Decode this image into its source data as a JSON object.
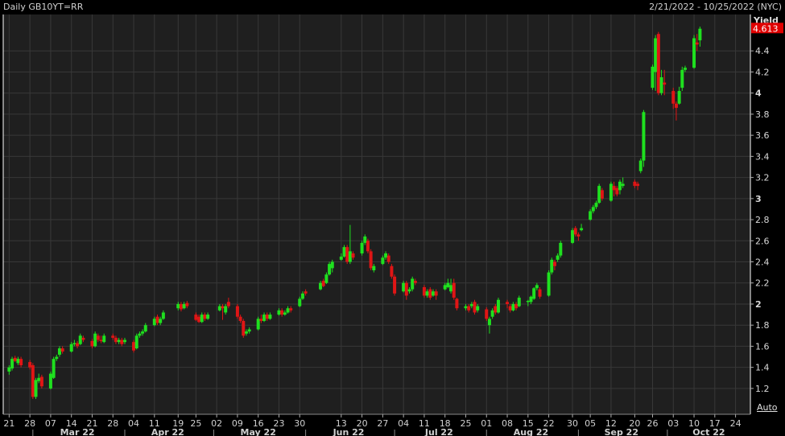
{
  "header": {
    "title": "Daily GB10YT=RR",
    "range": "2/21/2022 - 10/25/2022 (NYC)"
  },
  "auto_label": "Auto",
  "colors": {
    "up": "#1fe01f",
    "down": "#e01515",
    "background": "#1f1f1f",
    "grid": "#383838",
    "last_price_bg": "#e00000"
  },
  "chart_data": {
    "type": "candlestick",
    "title": "Daily GB10YT=RR",
    "ylabel": "Yield",
    "ylim": [
      0.955,
      4.745
    ],
    "yticks": [
      1.2,
      1.4,
      1.6,
      1.8,
      2,
      2.2,
      2.4,
      2.6,
      2.8,
      3,
      3.2,
      3.4,
      3.6,
      3.8,
      4,
      4.2,
      4.4
    ],
    "ytick_labels": [
      "1.2",
      "1.4",
      "1.6",
      "1.8",
      "2",
      "2.2",
      "2.4",
      "2.6",
      "2.8",
      "3",
      "3.2",
      "3.4",
      "3.6",
      "3.8",
      "4",
      "4.2",
      "4.4"
    ],
    "last_value": "4.613",
    "xlim": [
      "2022-02-19",
      "2022-10-29"
    ],
    "xticks": [
      {
        "date": "2022-02-21",
        "label": "21"
      },
      {
        "date": "2022-02-28",
        "label": "28"
      },
      {
        "date": "2022-03-07",
        "label": "07"
      },
      {
        "date": "2022-03-14",
        "label": "14"
      },
      {
        "date": "2022-03-21",
        "label": "21"
      },
      {
        "date": "2022-03-28",
        "label": "28"
      },
      {
        "date": "2022-04-04",
        "label": "04"
      },
      {
        "date": "2022-04-11",
        "label": "11"
      },
      {
        "date": "2022-04-19",
        "label": "19"
      },
      {
        "date": "2022-04-25",
        "label": "25"
      },
      {
        "date": "2022-05-02",
        "label": "02"
      },
      {
        "date": "2022-05-09",
        "label": "09"
      },
      {
        "date": "2022-05-16",
        "label": "16"
      },
      {
        "date": "2022-05-23",
        "label": "23"
      },
      {
        "date": "2022-05-30",
        "label": "30"
      },
      {
        "date": "2022-06-13",
        "label": "13"
      },
      {
        "date": "2022-06-20",
        "label": "20"
      },
      {
        "date": "2022-06-27",
        "label": "27"
      },
      {
        "date": "2022-07-04",
        "label": "04"
      },
      {
        "date": "2022-07-11",
        "label": "11"
      },
      {
        "date": "2022-07-18",
        "label": "18"
      },
      {
        "date": "2022-07-25",
        "label": "25"
      },
      {
        "date": "2022-08-01",
        "label": "01"
      },
      {
        "date": "2022-08-08",
        "label": "08"
      },
      {
        "date": "2022-08-15",
        "label": "15"
      },
      {
        "date": "2022-08-22",
        "label": "22"
      },
      {
        "date": "2022-08-30",
        "label": "30"
      },
      {
        "date": "2022-09-05",
        "label": "05"
      },
      {
        "date": "2022-09-12",
        "label": "12"
      },
      {
        "date": "2022-09-20",
        "label": "20"
      },
      {
        "date": "2022-09-26",
        "label": "26"
      },
      {
        "date": "2022-10-03",
        "label": "03"
      },
      {
        "date": "2022-10-10",
        "label": "10"
      },
      {
        "date": "2022-10-17",
        "label": "17"
      },
      {
        "date": "2022-10-24",
        "label": "24"
      }
    ],
    "months": [
      {
        "start": "2022-03-01",
        "end": "2022-03-31",
        "label": "Mar 22"
      },
      {
        "start": "2022-04-01",
        "end": "2022-04-30",
        "label": "Apr 22"
      },
      {
        "start": "2022-05-01",
        "end": "2022-05-31",
        "label": "May 22"
      },
      {
        "start": "2022-06-01",
        "end": "2022-06-30",
        "label": "Jun 22"
      },
      {
        "start": "2022-07-01",
        "end": "2022-07-31",
        "label": "Jul 22"
      },
      {
        "start": "2022-08-01",
        "end": "2022-08-31",
        "label": "Aug 22"
      },
      {
        "start": "2022-09-01",
        "end": "2022-09-30",
        "label": "Sep 22"
      },
      {
        "start": "2022-10-01",
        "end": "2022-10-31",
        "label": "Oct 22"
      }
    ],
    "candles_fields": [
      "date",
      "open",
      "high",
      "low",
      "close"
    ],
    "candles": [
      [
        "2022-02-21",
        1.36,
        1.42,
        1.33,
        1.4
      ],
      [
        "2022-02-22",
        1.39,
        1.5,
        1.37,
        1.48
      ],
      [
        "2022-02-23",
        1.49,
        1.51,
        1.45,
        1.46
      ],
      [
        "2022-02-24",
        1.44,
        1.5,
        1.42,
        1.48
      ],
      [
        "2022-02-25",
        1.48,
        1.5,
        1.4,
        1.42
      ],
      [
        "2022-02-28",
        1.45,
        1.47,
        1.38,
        1.4
      ],
      [
        "2022-03-01",
        1.42,
        1.44,
        1.1,
        1.12
      ],
      [
        "2022-03-02",
        1.12,
        1.3,
        1.1,
        1.28
      ],
      [
        "2022-03-03",
        1.27,
        1.34,
        1.25,
        1.3
      ],
      [
        "2022-03-04",
        1.31,
        1.33,
        1.2,
        1.22
      ],
      [
        "2022-03-07",
        1.2,
        1.36,
        1.19,
        1.34
      ],
      [
        "2022-03-08",
        1.3,
        1.5,
        1.29,
        1.48
      ],
      [
        "2022-03-09",
        1.48,
        1.52,
        1.46,
        1.5
      ],
      [
        "2022-03-10",
        1.52,
        1.6,
        1.5,
        1.58
      ],
      [
        "2022-03-11",
        1.58,
        1.6,
        1.53,
        1.55
      ],
      [
        "2022-03-14",
        1.55,
        1.64,
        1.54,
        1.62
      ],
      [
        "2022-03-15",
        1.62,
        1.66,
        1.6,
        1.63
      ],
      [
        "2022-03-16",
        1.63,
        1.65,
        1.58,
        1.6
      ],
      [
        "2022-03-17",
        1.62,
        1.72,
        1.61,
        1.7
      ],
      [
        "2022-03-18",
        1.68,
        1.7,
        1.64,
        1.66
      ],
      [
        "2022-03-21",
        1.65,
        1.67,
        1.58,
        1.6
      ],
      [
        "2022-03-22",
        1.6,
        1.74,
        1.59,
        1.72
      ],
      [
        "2022-03-23",
        1.7,
        1.72,
        1.64,
        1.66
      ],
      [
        "2022-03-24",
        1.66,
        1.7,
        1.63,
        1.65
      ],
      [
        "2022-03-25",
        1.64,
        1.72,
        1.63,
        1.7
      ],
      [
        "2022-03-28",
        1.7,
        1.72,
        1.66,
        1.68
      ],
      [
        "2022-03-29",
        1.68,
        1.7,
        1.62,
        1.64
      ],
      [
        "2022-03-30",
        1.64,
        1.68,
        1.62,
        1.66
      ],
      [
        "2022-03-31",
        1.66,
        1.68,
        1.6,
        1.62
      ],
      [
        "2022-04-01",
        1.64,
        1.68,
        1.62,
        1.66
      ],
      [
        "2022-04-04",
        1.64,
        1.66,
        1.54,
        1.56
      ],
      [
        "2022-04-05",
        1.58,
        1.72,
        1.57,
        1.7
      ],
      [
        "2022-04-06",
        1.7,
        1.74,
        1.68,
        1.72
      ],
      [
        "2022-04-07",
        1.72,
        1.76,
        1.7,
        1.74
      ],
      [
        "2022-04-08",
        1.74,
        1.82,
        1.73,
        1.8
      ],
      [
        "2022-04-11",
        1.8,
        1.88,
        1.79,
        1.86
      ],
      [
        "2022-04-12",
        1.88,
        1.9,
        1.8,
        1.82
      ],
      [
        "2022-04-13",
        1.82,
        1.88,
        1.8,
        1.86
      ],
      [
        "2022-04-14",
        1.86,
        1.94,
        1.85,
        1.92
      ],
      [
        "2022-04-19",
        1.96,
        2.02,
        1.94,
        2.0
      ],
      [
        "2022-04-20",
        2.0,
        2.02,
        1.93,
        1.95
      ],
      [
        "2022-04-21",
        1.96,
        2.02,
        1.95,
        2.0
      ],
      [
        "2022-04-22",
        2.01,
        2.03,
        1.96,
        1.98
      ],
      [
        "2022-04-25",
        1.9,
        1.92,
        1.84,
        1.85
      ],
      [
        "2022-04-26",
        1.88,
        1.9,
        1.82,
        1.83
      ],
      [
        "2022-04-27",
        1.83,
        1.92,
        1.82,
        1.9
      ],
      [
        "2022-04-28",
        1.9,
        1.92,
        1.84,
        1.86
      ],
      [
        "2022-04-29",
        1.86,
        1.92,
        1.85,
        1.9
      ],
      [
        "2022-05-03",
        1.94,
        2.0,
        1.93,
        1.98
      ],
      [
        "2022-05-04",
        1.98,
        2.0,
        1.85,
        1.96
      ],
      [
        "2022-05-05",
        1.92,
        2.0,
        1.9,
        1.98
      ],
      [
        "2022-05-06",
        2.02,
        2.06,
        1.96,
        1.98
      ],
      [
        "2022-05-09",
        1.98,
        2.0,
        1.86,
        1.88
      ],
      [
        "2022-05-10",
        1.88,
        1.9,
        1.82,
        1.84
      ],
      [
        "2022-05-11",
        1.84,
        1.86,
        1.68,
        1.7
      ],
      [
        "2022-05-12",
        1.72,
        1.76,
        1.7,
        1.74
      ],
      [
        "2022-05-13",
        1.74,
        1.78,
        1.72,
        1.76
      ],
      [
        "2022-05-16",
        1.76,
        1.88,
        1.75,
        1.86
      ],
      [
        "2022-05-17",
        1.86,
        1.9,
        1.82,
        1.84
      ],
      [
        "2022-05-18",
        1.84,
        1.92,
        1.83,
        1.9
      ],
      [
        "2022-05-19",
        1.9,
        1.92,
        1.84,
        1.86
      ],
      [
        "2022-05-20",
        1.86,
        1.92,
        1.85,
        1.9
      ],
      [
        "2022-05-23",
        1.9,
        1.96,
        1.89,
        1.94
      ],
      [
        "2022-05-24",
        1.94,
        1.96,
        1.88,
        1.9
      ],
      [
        "2022-05-25",
        1.9,
        1.94,
        1.89,
        1.92
      ],
      [
        "2022-05-26",
        1.92,
        1.98,
        1.91,
        1.96
      ],
      [
        "2022-05-27",
        1.96,
        1.98,
        1.92,
        1.94
      ],
      [
        "2022-05-30",
        1.98,
        2.07,
        1.97,
        2.05
      ],
      [
        "2022-05-31",
        2.05,
        2.12,
        2.04,
        2.1
      ],
      [
        "2022-06-01",
        2.12,
        2.14,
        2.08,
        2.1
      ],
      [
        "2022-06-06",
        2.14,
        2.22,
        2.13,
        2.2
      ],
      [
        "2022-06-07",
        2.22,
        2.24,
        2.16,
        2.17
      ],
      [
        "2022-06-08",
        2.2,
        2.3,
        2.19,
        2.28
      ],
      [
        "2022-06-09",
        2.28,
        2.4,
        2.27,
        2.38
      ],
      [
        "2022-06-10",
        2.34,
        2.42,
        2.3,
        2.4
      ],
      [
        "2022-06-13",
        2.42,
        2.48,
        2.41,
        2.45
      ],
      [
        "2022-06-14",
        2.45,
        2.56,
        2.44,
        2.54
      ],
      [
        "2022-06-15",
        2.54,
        2.56,
        2.38,
        2.4
      ],
      [
        "2022-06-16",
        2.4,
        2.75,
        2.38,
        2.5
      ],
      [
        "2022-06-17",
        2.48,
        2.5,
        2.42,
        2.44
      ],
      [
        "2022-06-20",
        2.48,
        2.6,
        2.46,
        2.58
      ],
      [
        "2022-06-21",
        2.58,
        2.66,
        2.56,
        2.64
      ],
      [
        "2022-06-22",
        2.6,
        2.62,
        2.48,
        2.5
      ],
      [
        "2022-06-23",
        2.5,
        2.52,
        2.32,
        2.34
      ],
      [
        "2022-06-24",
        2.32,
        2.38,
        2.3,
        2.36
      ],
      [
        "2022-06-27",
        2.38,
        2.46,
        2.37,
        2.44
      ],
      [
        "2022-06-28",
        2.44,
        2.5,
        2.42,
        2.48
      ],
      [
        "2022-06-29",
        2.46,
        2.48,
        2.38,
        2.4
      ],
      [
        "2022-06-30",
        2.36,
        2.38,
        2.24,
        2.26
      ],
      [
        "2022-07-01",
        2.26,
        2.28,
        2.08,
        2.1
      ],
      [
        "2022-07-04",
        2.12,
        2.22,
        2.11,
        2.2
      ],
      [
        "2022-07-05",
        2.2,
        2.22,
        2.04,
        2.08
      ],
      [
        "2022-07-06",
        2.12,
        2.16,
        2.1,
        2.14
      ],
      [
        "2022-07-07",
        2.14,
        2.26,
        2.12,
        2.24
      ],
      [
        "2022-07-08",
        2.22,
        2.24,
        2.18,
        2.2
      ],
      [
        "2022-07-11",
        2.16,
        2.18,
        2.06,
        2.08
      ],
      [
        "2022-07-12",
        2.08,
        2.14,
        2.06,
        2.12
      ],
      [
        "2022-07-13",
        2.14,
        2.16,
        2.04,
        2.06
      ],
      [
        "2022-07-14",
        2.08,
        2.14,
        2.07,
        2.12
      ],
      [
        "2022-07-15",
        2.12,
        2.14,
        2.04,
        2.08
      ],
      [
        "2022-07-18",
        2.14,
        2.2,
        2.13,
        2.18
      ],
      [
        "2022-07-19",
        2.16,
        2.24,
        2.15,
        2.2
      ],
      [
        "2022-07-20",
        2.12,
        2.24,
        2.1,
        2.18
      ],
      [
        "2022-07-21",
        2.2,
        2.24,
        2.04,
        2.06
      ],
      [
        "2022-07-22",
        2.05,
        2.06,
        1.94,
        1.96
      ],
      [
        "2022-07-25",
        1.96,
        2.0,
        1.94,
        1.98
      ],
      [
        "2022-07-26",
        1.98,
        2.0,
        1.92,
        1.94
      ],
      [
        "2022-07-27",
        1.98,
        2.02,
        1.96,
        2.0
      ],
      [
        "2022-07-28",
        2.02,
        2.04,
        1.9,
        1.92
      ],
      [
        "2022-07-29",
        1.94,
        2.0,
        1.92,
        1.98
      ],
      [
        "2022-08-01",
        1.95,
        1.97,
        1.84,
        1.86
      ],
      [
        "2022-08-02",
        1.8,
        1.88,
        1.72,
        1.86
      ],
      [
        "2022-08-03",
        1.88,
        1.96,
        1.86,
        1.94
      ],
      [
        "2022-08-04",
        1.98,
        2.0,
        1.9,
        1.92
      ],
      [
        "2022-08-05",
        1.92,
        2.06,
        1.91,
        2.04
      ],
      [
        "2022-08-08",
        2.02,
        2.04,
        1.96,
        2.0
      ],
      [
        "2022-08-09",
        1.98,
        2.0,
        1.92,
        1.94
      ],
      [
        "2022-08-10",
        1.94,
        2.02,
        1.93,
        2.0
      ],
      [
        "2022-08-11",
        2.0,
        2.02,
        1.94,
        1.96
      ],
      [
        "2022-08-12",
        1.98,
        2.08,
        1.97,
        2.06
      ],
      [
        "2022-08-15",
        2.02,
        2.04,
        1.98,
        2.03
      ],
      [
        "2022-08-16",
        2.02,
        2.08,
        2.0,
        2.07
      ],
      [
        "2022-08-17",
        2.05,
        2.16,
        2.04,
        2.15
      ],
      [
        "2022-08-18",
        2.15,
        2.2,
        2.13,
        2.18
      ],
      [
        "2022-08-19",
        2.14,
        2.16,
        2.05,
        2.07
      ],
      [
        "2022-08-22",
        2.08,
        2.32,
        2.07,
        2.3
      ],
      [
        "2022-08-23",
        2.3,
        2.44,
        2.28,
        2.42
      ],
      [
        "2022-08-24",
        2.4,
        2.42,
        2.32,
        2.36
      ],
      [
        "2022-08-25",
        2.42,
        2.48,
        2.4,
        2.46
      ],
      [
        "2022-08-26",
        2.46,
        2.6,
        2.44,
        2.58
      ],
      [
        "2022-08-30",
        2.58,
        2.72,
        2.57,
        2.7
      ],
      [
        "2022-08-31",
        2.72,
        2.74,
        2.64,
        2.66
      ],
      [
        "2022-09-01",
        2.66,
        2.68,
        2.6,
        2.64
      ],
      [
        "2022-09-02",
        2.7,
        2.76,
        2.69,
        2.72
      ],
      [
        "2022-09-05",
        2.8,
        2.9,
        2.79,
        2.88
      ],
      [
        "2022-09-06",
        2.88,
        2.94,
        2.86,
        2.92
      ],
      [
        "2022-09-07",
        2.92,
        2.98,
        2.9,
        2.96
      ],
      [
        "2022-09-08",
        2.96,
        3.14,
        2.95,
        3.12
      ],
      [
        "2022-09-09",
        3.08,
        3.1,
        2.98,
        3.0
      ],
      [
        "2022-09-12",
        2.98,
        3.16,
        2.97,
        3.14
      ],
      [
        "2022-09-13",
        3.12,
        3.16,
        3.02,
        3.08
      ],
      [
        "2022-09-14",
        3.1,
        3.12,
        3.02,
        3.04
      ],
      [
        "2022-09-15",
        3.08,
        3.18,
        3.04,
        3.16
      ],
      [
        "2022-09-16",
        3.12,
        3.2,
        3.1,
        3.14
      ],
      [
        "2022-09-20",
        3.16,
        3.18,
        3.1,
        3.12
      ],
      [
        "2022-09-21",
        3.14,
        3.16,
        3.08,
        3.12
      ],
      [
        "2022-09-22",
        3.26,
        3.38,
        3.24,
        3.36
      ],
      [
        "2022-09-23",
        3.36,
        3.84,
        3.3,
        3.82
      ],
      [
        "2022-09-26",
        4.05,
        4.27,
        4.03,
        4.25
      ],
      [
        "2022-09-27",
        4.2,
        4.55,
        4.02,
        4.52
      ],
      [
        "2022-09-28",
        4.56,
        4.58,
        3.98,
        4.0
      ],
      [
        "2022-09-29",
        4.0,
        4.22,
        3.98,
        4.15
      ],
      [
        "2022-09-30",
        4.1,
        4.22,
        3.98,
        4.08
      ],
      [
        "2022-10-03",
        4.02,
        4.05,
        3.85,
        3.9
      ],
      [
        "2022-10-04",
        3.9,
        3.92,
        3.74,
        3.86
      ],
      [
        "2022-10-05",
        3.9,
        4.06,
        3.89,
        4.02
      ],
      [
        "2022-10-06",
        4.05,
        4.25,
        4.02,
        4.22
      ],
      [
        "2022-10-07",
        4.22,
        4.26,
        4.2,
        4.24
      ],
      [
        "2022-10-10",
        4.24,
        4.55,
        4.23,
        4.52
      ],
      [
        "2022-10-11",
        4.48,
        4.56,
        4.4,
        4.46
      ],
      [
        "2022-10-12",
        4.5,
        4.63,
        4.44,
        4.61
      ]
    ]
  }
}
